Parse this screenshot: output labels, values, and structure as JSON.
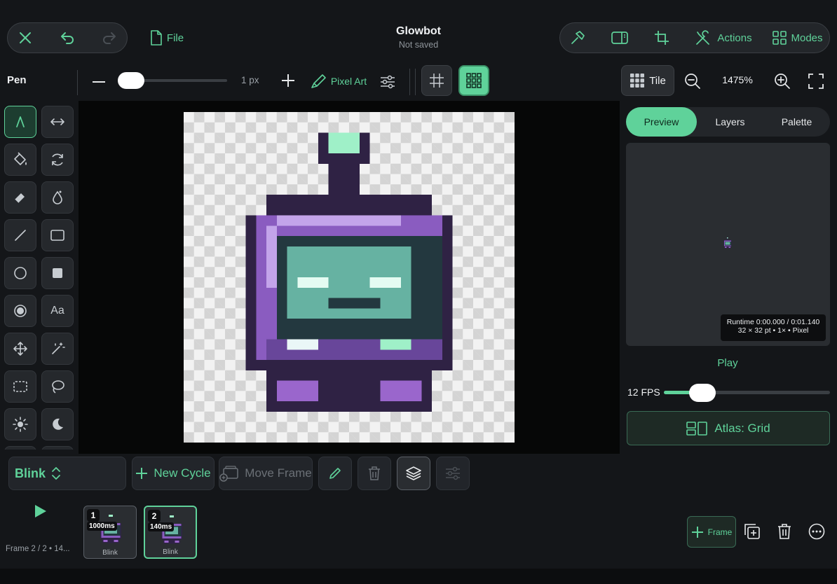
{
  "header": {
    "title": "Glowbot",
    "subtitle": "Not saved",
    "file_label": "File",
    "actions_label": "Actions",
    "modes_label": "Modes"
  },
  "toolbar": {
    "tool_name": "Pen",
    "brush_size": "1 px",
    "brush_size_value": 1,
    "pixel_art_label": "Pixel Art",
    "tile_label": "Tile",
    "zoom": "1475%"
  },
  "tabs": [
    "Preview",
    "Layers",
    "Palette"
  ],
  "preview": {
    "runtime_line1": "Runtime 0:00.000 / 0:01.140",
    "runtime_line2": "32 × 32 pt • 1× • Pixel",
    "play_label": "Play",
    "fps_label": "12 FPS",
    "fps_value": 12,
    "atlas_label": "Atlas: Grid"
  },
  "cycle": {
    "name": "Blink",
    "new_cycle_label": "New Cycle",
    "move_frame_label": "Move Frame"
  },
  "frames": [
    {
      "number": "1",
      "duration": "1000ms",
      "name": "Blink"
    },
    {
      "number": "2",
      "duration": "140ms",
      "name": "Blink"
    }
  ],
  "frame_status": "Frame 2 / 2 • 14...",
  "add_frame_label": "Frame",
  "colors": {
    "accent": "#5fd29a",
    "background": "#141619",
    "panel": "#23262a"
  }
}
